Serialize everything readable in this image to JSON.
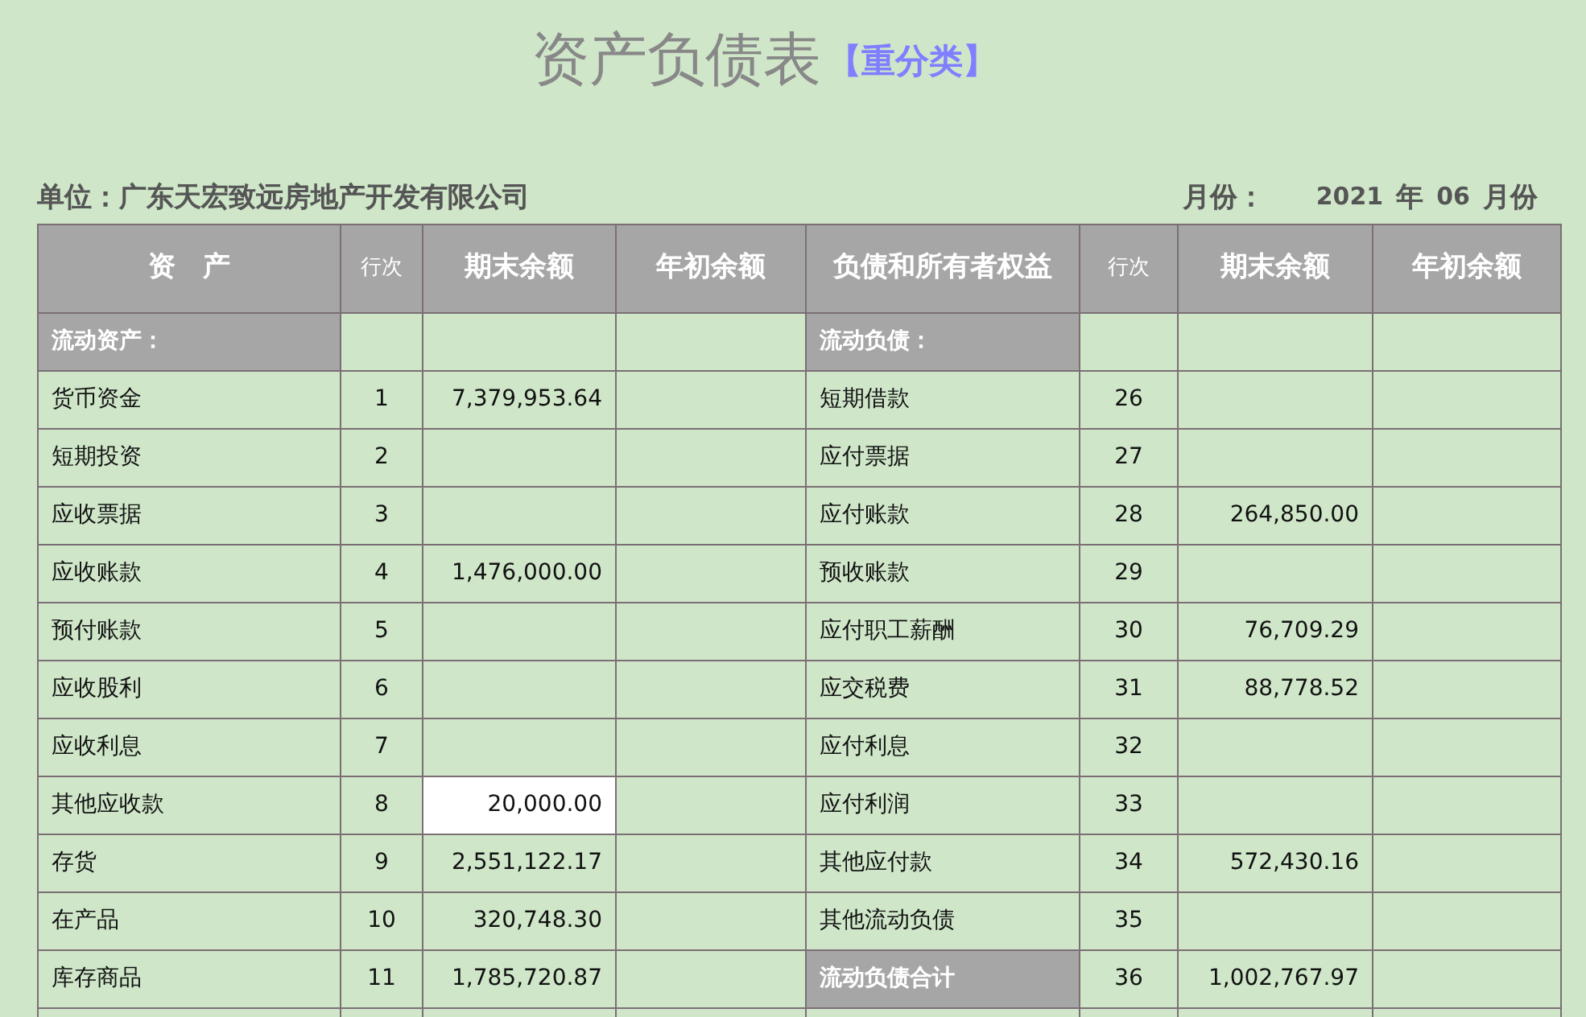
{
  "title": {
    "main": "资产负债表",
    "tag": "【重分类】"
  },
  "unit": {
    "label": "单位：广东天宏致远房地产开发有限公司"
  },
  "period": {
    "label": "月份：",
    "year": "2021",
    "year_unit": "年",
    "month": "06",
    "month_unit": "月份"
  },
  "columns": [
    "资　产",
    "行次",
    "期末余额",
    "年初余额",
    "负债和所有者权益",
    "行次",
    "期末余额",
    "年初余额"
  ],
  "rows": [
    {
      "left": {
        "kind": "section",
        "item": "流动资产：",
        "end_selected": false
      },
      "right": {
        "kind": "section",
        "item": "流动负债：",
        "end_selected": false
      }
    },
    {
      "left": {
        "kind": "item",
        "item": "货币资金",
        "line": "1",
        "end": "7,379,953.64",
        "end_selected": false
      },
      "right": {
        "kind": "item",
        "item": "短期借款",
        "line": "26",
        "end_selected": false
      }
    },
    {
      "left": {
        "kind": "item",
        "item": "短期投资",
        "line": "2",
        "end_selected": false
      },
      "right": {
        "kind": "item",
        "item": "应付票据",
        "line": "27",
        "end_selected": false
      }
    },
    {
      "left": {
        "kind": "item",
        "item": "应收票据",
        "line": "3",
        "end_selected": false
      },
      "right": {
        "kind": "item",
        "item": "应付账款",
        "line": "28",
        "end": "264,850.00",
        "end_selected": false
      }
    },
    {
      "left": {
        "kind": "item",
        "item": "应收账款",
        "line": "4",
        "end": "1,476,000.00",
        "end_selected": false
      },
      "right": {
        "kind": "item",
        "item": "预收账款",
        "line": "29",
        "end_selected": false
      }
    },
    {
      "left": {
        "kind": "item",
        "item": "预付账款",
        "line": "5",
        "end_selected": false
      },
      "right": {
        "kind": "item",
        "item": "应付职工薪酬",
        "line": "30",
        "end": "76,709.29",
        "end_selected": false
      }
    },
    {
      "left": {
        "kind": "item",
        "item": "应收股利",
        "line": "6",
        "end_selected": false
      },
      "right": {
        "kind": "item",
        "item": "应交税费",
        "line": "31",
        "end": "88,778.52",
        "end_selected": false
      }
    },
    {
      "left": {
        "kind": "item",
        "item": "应收利息",
        "line": "7",
        "end_selected": false
      },
      "right": {
        "kind": "item",
        "item": "应付利息",
        "line": "32",
        "end_selected": false
      }
    },
    {
      "left": {
        "kind": "item",
        "item": "其他应收款",
        "line": "8",
        "end": "20,000.00",
        "end_selected": true
      },
      "right": {
        "kind": "item",
        "item": "应付利润",
        "line": "33",
        "end_selected": false
      }
    },
    {
      "left": {
        "kind": "item",
        "item": "存货",
        "line": "9",
        "end": "2,551,122.17",
        "end_selected": false
      },
      "right": {
        "kind": "item",
        "item": "其他应付款",
        "line": "34",
        "end": "572,430.16",
        "end_selected": false
      }
    },
    {
      "left": {
        "kind": "item",
        "item": "在产品",
        "line": "10",
        "end": "320,748.30",
        "end_selected": false
      },
      "right": {
        "kind": "item",
        "item": "其他流动负债",
        "line": "35",
        "end_selected": false
      }
    },
    {
      "left": {
        "kind": "item",
        "item": "库存商品",
        "line": "11",
        "end": "1,785,720.87",
        "end_selected": false
      },
      "right": {
        "kind": "section",
        "item": "流动负债合计",
        "line": "36",
        "end": "1,002,767.97",
        "end_selected": false
      }
    }
  ]
}
